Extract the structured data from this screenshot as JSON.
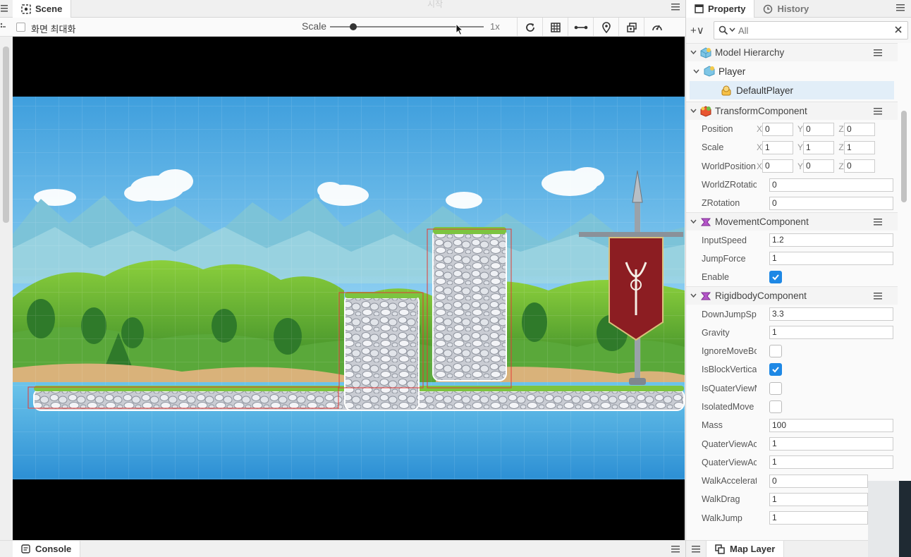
{
  "scene_tab": {
    "label": "Scene"
  },
  "overlay_text": "시작",
  "toolbar": {
    "maximize_label": "화면 최대화",
    "scale_label": "Scale",
    "scale_value": "1x",
    "scale_slider_fraction": 0.15
  },
  "property_panel": {
    "tabs": [
      {
        "label": "Property"
      },
      {
        "label": "History"
      }
    ],
    "add_label": "+∨",
    "search": {
      "placeholder": "All"
    },
    "model_hierarchy": {
      "title": "Model Hierarchy",
      "player": "Player",
      "default_player": "DefaultPlayer"
    },
    "transform": {
      "title": "TransformComponent",
      "position": {
        "label": "Position",
        "x": "0",
        "y": "0",
        "z": "0"
      },
      "scale": {
        "label": "Scale",
        "x": "1",
        "y": "1",
        "z": "1"
      },
      "world_position": {
        "label": "WorldPosition",
        "x": "0",
        "y": "0",
        "z": "0"
      },
      "world_z_rotation": {
        "label": "WorldZRotation",
        "value": "0"
      },
      "z_rotation": {
        "label": "ZRotation",
        "value": "0"
      }
    },
    "movement": {
      "title": "MovementComponent",
      "input_speed": {
        "label": "InputSpeed",
        "value": "1.2"
      },
      "jump_force": {
        "label": "JumpForce",
        "value": "1"
      },
      "enable": {
        "label": "Enable",
        "checked": true
      }
    },
    "rigidbody": {
      "title": "RigidbodyComponent",
      "down_jump_speed": {
        "label": "DownJumpSpee",
        "value": "3.3"
      },
      "gravity": {
        "label": "Gravity",
        "value": "1"
      },
      "ignore_move_bound": {
        "label": "IgnoreMoveBou",
        "checked": false
      },
      "is_block_vertical": {
        "label": "IsBlockVerticalLi",
        "checked": true
      },
      "is_quater_view": {
        "label": "IsQuaterViewMo",
        "checked": false
      },
      "isolated_move": {
        "label": "IsolatedMove",
        "checked": false
      },
      "mass": {
        "label": "Mass",
        "value": "100"
      },
      "quater_view_acce_1": {
        "label": "QuaterViewAcce",
        "value": "1"
      },
      "quater_view_acce_2": {
        "label": "QuaterViewAcce",
        "value": "1"
      },
      "walk_acceleration": {
        "label": "WalkAcceleratio",
        "value": "0"
      },
      "walk_drag": {
        "label": "WalkDrag",
        "value": "1"
      },
      "walk_jump": {
        "label": "WalkJump",
        "value": "1"
      }
    }
  },
  "bottom": {
    "console_label": "Console",
    "map_layer_label": "Map Layer"
  },
  "colors": {
    "accent": "#1e88e5",
    "sky": "#5cb6e8",
    "water": "#3a9fdc",
    "banner": "#8c1d22"
  }
}
